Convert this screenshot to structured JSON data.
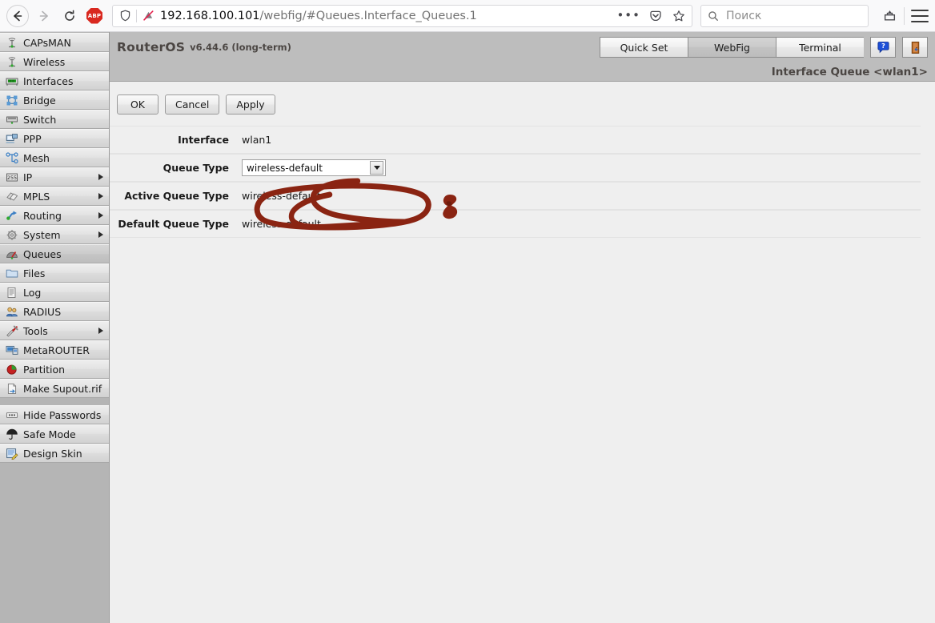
{
  "browser": {
    "back_icon": "back-arrow-icon",
    "forward_icon": "forward-arrow-icon",
    "reload_icon": "reload-icon",
    "adblock_label": "ABP",
    "url_host": "192.168.100.101",
    "url_path": "/webfig/#Queues.Interface_Queues.1",
    "url_full": "192.168.100.101/webfig/#Queues.Interface_Queues.1",
    "shield_icon": "shield-icon",
    "permissions_icon": "blocked-permission-icon",
    "page_actions_icon": "page-actions-ellipsis-icon",
    "pocket_icon": "pocket-icon",
    "bookmark_icon": "bookmark-star-icon",
    "search_placeholder": "Поиск",
    "search_value": "",
    "search_icon": "search-icon",
    "library_icon": "library-save-icon",
    "menu_icon": "hamburger-menu-icon"
  },
  "sidebar": {
    "groups": [
      {
        "items": [
          {
            "label": "CAPsMAN",
            "icon": "antenna-icon",
            "submenu": false,
            "active": false
          },
          {
            "label": "Wireless",
            "icon": "antenna-icon",
            "submenu": false,
            "active": false
          },
          {
            "label": "Interfaces",
            "icon": "network-card-icon",
            "submenu": false,
            "active": false
          },
          {
            "label": "Bridge",
            "icon": "bridge-icon",
            "submenu": false,
            "active": false
          },
          {
            "label": "Switch",
            "icon": "switch-icon",
            "submenu": false,
            "active": false
          },
          {
            "label": "PPP",
            "icon": "ppp-icon",
            "submenu": false,
            "active": false
          },
          {
            "label": "Mesh",
            "icon": "mesh-icon",
            "submenu": false,
            "active": false
          },
          {
            "label": "IP",
            "icon": "ip-255-icon",
            "submenu": true,
            "active": false
          },
          {
            "label": "MPLS",
            "icon": "mpls-tags-icon",
            "submenu": true,
            "active": false
          },
          {
            "label": "Routing",
            "icon": "routing-icon",
            "submenu": true,
            "active": false
          },
          {
            "label": "System",
            "icon": "gear-icon",
            "submenu": true,
            "active": false
          },
          {
            "label": "Queues",
            "icon": "queues-gauge-icon",
            "submenu": false,
            "active": true
          },
          {
            "label": "Files",
            "icon": "folder-icon",
            "submenu": false,
            "active": false
          },
          {
            "label": "Log",
            "icon": "log-icon",
            "submenu": false,
            "active": false
          },
          {
            "label": "RADIUS",
            "icon": "radius-users-icon",
            "submenu": false,
            "active": false
          },
          {
            "label": "Tools",
            "icon": "tools-icon",
            "submenu": true,
            "active": false
          },
          {
            "label": "MetaROUTER",
            "icon": "metarouter-icon",
            "submenu": false,
            "active": false
          },
          {
            "label": "Partition",
            "icon": "partition-pie-icon",
            "submenu": false,
            "active": false
          },
          {
            "label": "Make Supout.rif",
            "icon": "supout-file-icon",
            "submenu": false,
            "active": false
          }
        ]
      },
      {
        "items": [
          {
            "label": "Hide Passwords",
            "icon": "hide-passwords-icon",
            "submenu": false,
            "active": false
          },
          {
            "label": "Safe Mode",
            "icon": "umbrella-icon",
            "submenu": false,
            "active": false
          },
          {
            "label": "Design Skin",
            "icon": "design-skin-icon",
            "submenu": false,
            "active": false
          }
        ]
      }
    ]
  },
  "header": {
    "product": "RouterOS",
    "version": "v6.44.6 (long-term)",
    "tabs": [
      {
        "label": "Quick Set",
        "active": false
      },
      {
        "label": "WebFig",
        "active": true
      },
      {
        "label": "Terminal",
        "active": false
      }
    ],
    "help_icon": "help-question-icon",
    "logout_icon": "logout-door-icon"
  },
  "page": {
    "title": "Interface Queue <wlan1>",
    "buttons": [
      {
        "label": "OK",
        "name": "ok-button"
      },
      {
        "label": "Cancel",
        "name": "cancel-button"
      },
      {
        "label": "Apply",
        "name": "apply-button"
      }
    ],
    "fields": [
      {
        "label": "Interface",
        "value": "wlan1",
        "type": "text",
        "name": "interface"
      },
      {
        "label": "Queue Type",
        "value": "wireless-default",
        "type": "select",
        "name": "queue-type"
      },
      {
        "label": "Active Queue Type",
        "value": "wireless-default",
        "type": "text",
        "name": "active-queue-type"
      },
      {
        "label": "Default Queue Type",
        "value": "wireless-default",
        "type": "text",
        "name": "default-queue-type"
      }
    ]
  },
  "annotation": {
    "shape": "hand-drawn-ellipse",
    "color": "#8a2412",
    "target": "queue-type-select"
  },
  "colors": {
    "chrome_bg": "#f9f9fa",
    "sidebar_bg": "#b5b5b5",
    "header_bg": "#bdbdbd",
    "content_bg": "#efefef",
    "annotation": "#8a2412"
  }
}
